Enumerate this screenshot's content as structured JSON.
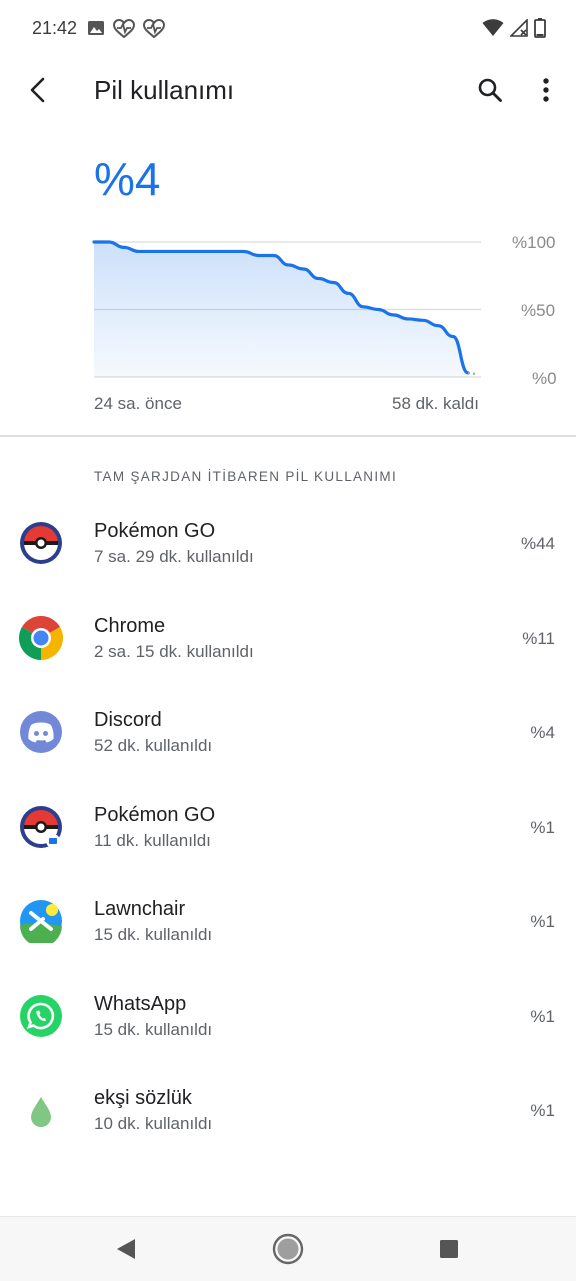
{
  "status_bar": {
    "time": "21:42",
    "left_icons": [
      "image-icon",
      "heart-monitor-icon",
      "heart-monitor-icon"
    ],
    "right_icons": [
      "wifi-icon",
      "signal-icon",
      "battery-icon"
    ]
  },
  "app_bar": {
    "title": "Pil kullanımı",
    "back_icon": "back-arrow-icon",
    "search_icon": "search-icon",
    "more_icon": "more-vert-icon"
  },
  "battery": {
    "level_text": "%4",
    "accent_color": "#1a73e8"
  },
  "chart_data": {
    "type": "area",
    "y_ticks": [
      "%100",
      "%50",
      "%0"
    ],
    "ylim": [
      0,
      100
    ],
    "x_start_label": "24 sa. önce",
    "x_end_label": "58 dk. kaldı",
    "values": [
      100,
      100,
      96,
      93,
      93,
      93,
      93,
      93,
      93,
      93,
      93,
      90,
      90,
      83,
      80,
      73,
      70,
      62,
      52,
      50,
      46,
      43,
      42,
      38,
      30,
      3
    ],
    "projection": [
      3,
      2
    ],
    "line_color": "#1a73e8",
    "grid": true
  },
  "section": {
    "header": "TAM ŞARJDAN İTİBAREN PİL KULLANIMI"
  },
  "apps": [
    {
      "name": "Pokémon GO",
      "usage": "7 sa. 29 dk. kullanıldı",
      "percent": "%44",
      "icon": "pokeball-icon"
    },
    {
      "name": "Chrome",
      "usage": "2 sa. 15 dk. kullanıldı",
      "percent": "%11",
      "icon": "chrome-icon"
    },
    {
      "name": "Discord",
      "usage": "52 dk. kullanıldı",
      "percent": "%4",
      "icon": "discord-icon"
    },
    {
      "name": "Pokémon GO",
      "usage": "11 dk. kullanıldı",
      "percent": "%1",
      "icon": "pokeball-work-icon"
    },
    {
      "name": "Lawnchair",
      "usage": "15 dk. kullanıldı",
      "percent": "%1",
      "icon": "lawnchair-icon"
    },
    {
      "name": "WhatsApp",
      "usage": "15 dk. kullanıldı",
      "percent": "%1",
      "icon": "whatsapp-icon"
    },
    {
      "name": "ekşi sözlük",
      "usage": "10 dk. kullanıldı",
      "percent": "%1",
      "icon": "eksi-sozluk-icon"
    }
  ],
  "nav_bar": {
    "buttons": [
      "nav-back-icon",
      "nav-home-icon",
      "nav-recents-icon"
    ]
  }
}
